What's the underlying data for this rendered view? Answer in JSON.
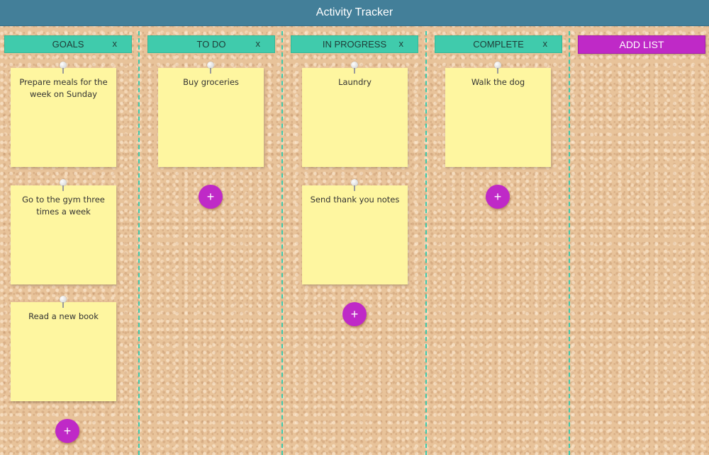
{
  "header": {
    "title": "Activity Tracker"
  },
  "lists": [
    {
      "title": "GOALS",
      "close": "x",
      "cards": [
        "Prepare meals for the week on Sunday",
        "Go to the gym three times a week",
        "Read a new book"
      ]
    },
    {
      "title": "TO DO",
      "close": "x",
      "cards": [
        "Buy groceries"
      ]
    },
    {
      "title": "IN PROGRESS",
      "close": "x",
      "cards": [
        "Laundry",
        "Send thank you notes"
      ]
    },
    {
      "title": "COMPLETE",
      "close": "x",
      "cards": [
        "Walk the dog"
      ]
    }
  ],
  "add_card_label": "+",
  "add_list_label": "ADD LIST",
  "colors": {
    "header": "#437f99",
    "list_header": "#40cbac",
    "accent": "#bf29c7",
    "note": "#fef6a0"
  }
}
